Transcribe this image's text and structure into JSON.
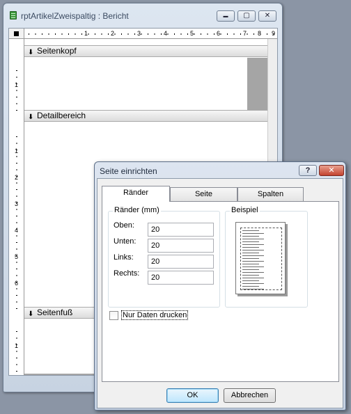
{
  "report_window": {
    "title": "rptArtikelZweispaltig : Bericht",
    "minimize_glyph": "▬",
    "maximize_glyph": "▢",
    "close_glyph": "✕",
    "ruler_h": [
      "1",
      "2",
      "3",
      "4",
      "5",
      "6",
      "7",
      "8",
      "9"
    ],
    "ruler_v_header": [
      "1"
    ],
    "ruler_v_detail": [
      "1",
      "2",
      "3",
      "4",
      "5",
      "6"
    ],
    "ruler_v_footer": [
      "1"
    ],
    "sections": {
      "header": "Seitenkopf",
      "detail": "Detailbereich",
      "footer": "Seitenfuß"
    },
    "section_arrow": "⬇"
  },
  "dialog": {
    "title": "Seite einrichten",
    "help_glyph": "?",
    "close_glyph": "✕",
    "tabs": [
      "Ränder",
      "Seite",
      "Spalten"
    ],
    "active_tab": "Ränder",
    "margins_group": "Ränder (mm)",
    "fields": [
      {
        "label": "Oben:",
        "value": "20"
      },
      {
        "label": "Unten:",
        "value": "20"
      },
      {
        "label": "Links:",
        "value": "20"
      },
      {
        "label": "Rechts:",
        "value": "20"
      }
    ],
    "preview_group": "Beispiel",
    "print_data_only_label": "Nur Daten drucken",
    "print_data_only_checked": false,
    "ok_label": "OK",
    "cancel_label": "Abbrechen"
  },
  "colors": {
    "desktop": "#8b95a5",
    "close_red": "#c3432f",
    "default_button": "#bee6fd"
  }
}
